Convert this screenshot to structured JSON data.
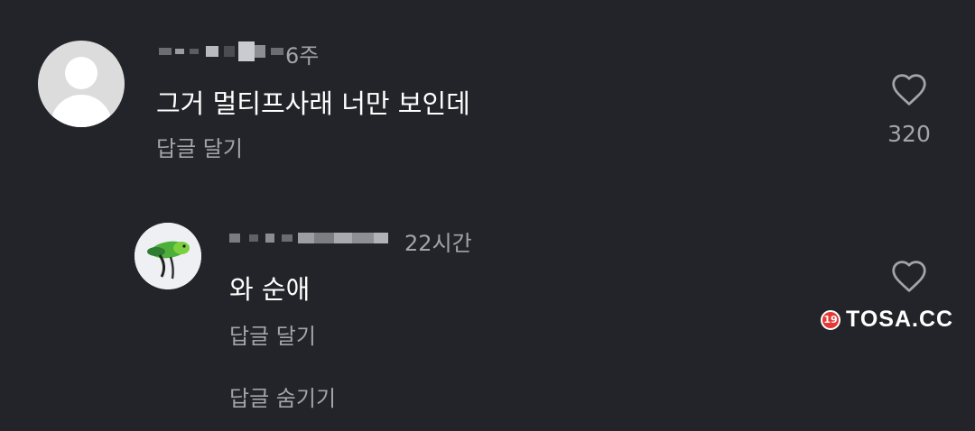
{
  "comments": [
    {
      "time": "6주",
      "text": "그거 멀티프사래 너만 보인데",
      "reply_label": "답글 달기",
      "like_count": "320"
    },
    {
      "time": "22시간",
      "text": "와 순애",
      "reply_label": "답글 달기",
      "hide_replies_label": "답글 숨기기"
    }
  ],
  "watermark": {
    "badge": "19",
    "text": "TOSA.CC"
  },
  "colors": {
    "background": "#232429",
    "secondary_text": "#a2a4ab",
    "primary_text": "#ffffff"
  }
}
